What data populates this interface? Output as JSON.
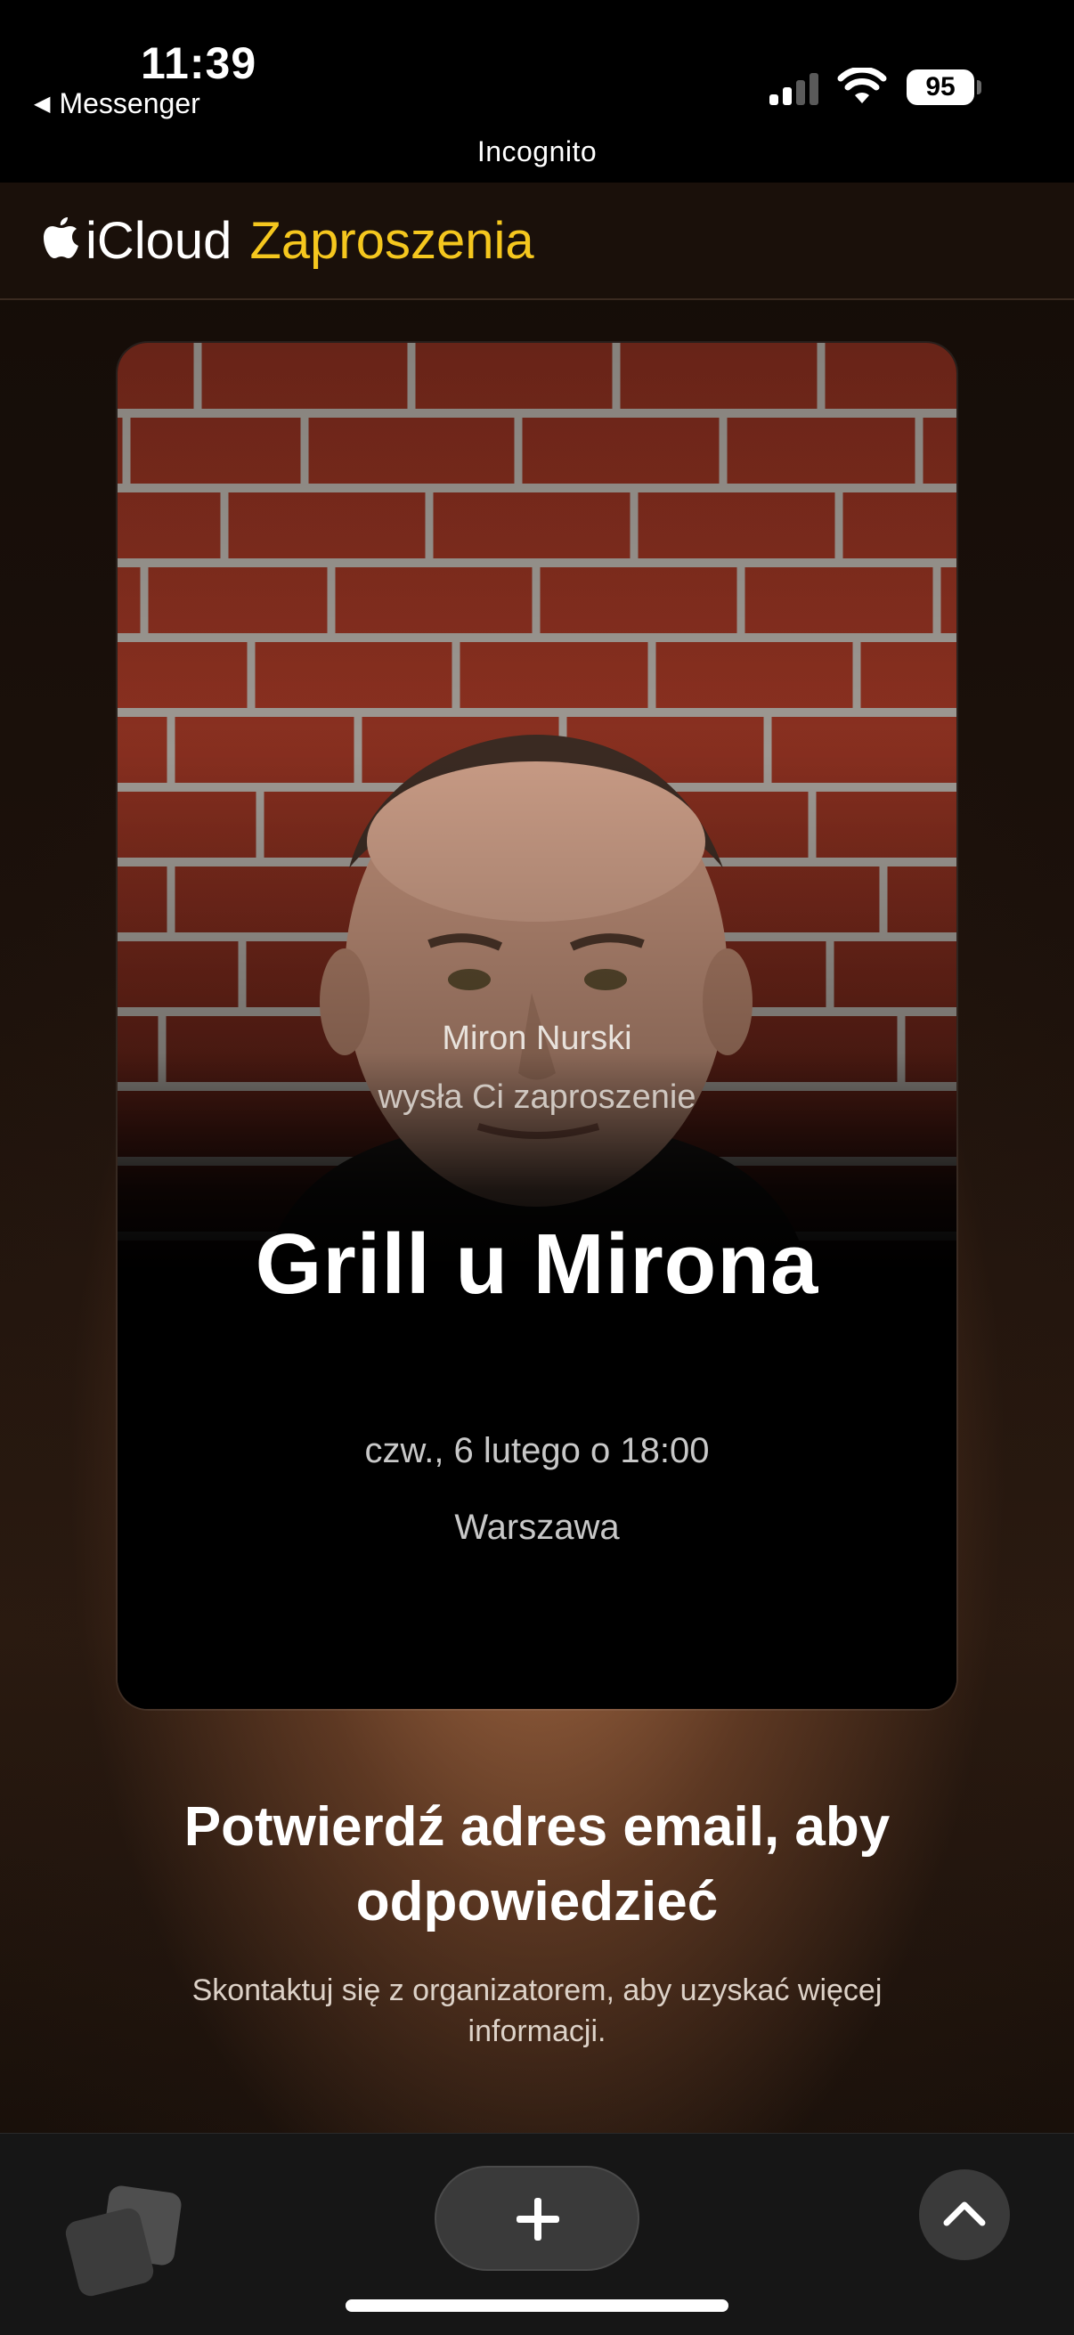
{
  "status_bar": {
    "time": "11:39",
    "back_app": "Messenger",
    "battery": "95",
    "mode": "Incognito"
  },
  "header": {
    "brand": "iCloud",
    "brand_accent": "Zaproszenia",
    "accent_color": "#f5c71e"
  },
  "invite": {
    "sender": "Miron Nurski",
    "invite_line": "wysła Ci zaproszenie",
    "title": "Grill u Mirona",
    "date": "czw., 6 lutego o 18:00",
    "place": "Warszawa"
  },
  "confirm": {
    "title": "Potwierdź adres email, aby odpowiedzieć",
    "subtitle": "Skontaktuj się z organizatorem, aby uzyskać więcej informacji."
  },
  "toolbar": {
    "tabs_icon": "tabs-icon",
    "new_tab_icon": "plus-icon",
    "up_icon": "chevron-up-icon"
  }
}
